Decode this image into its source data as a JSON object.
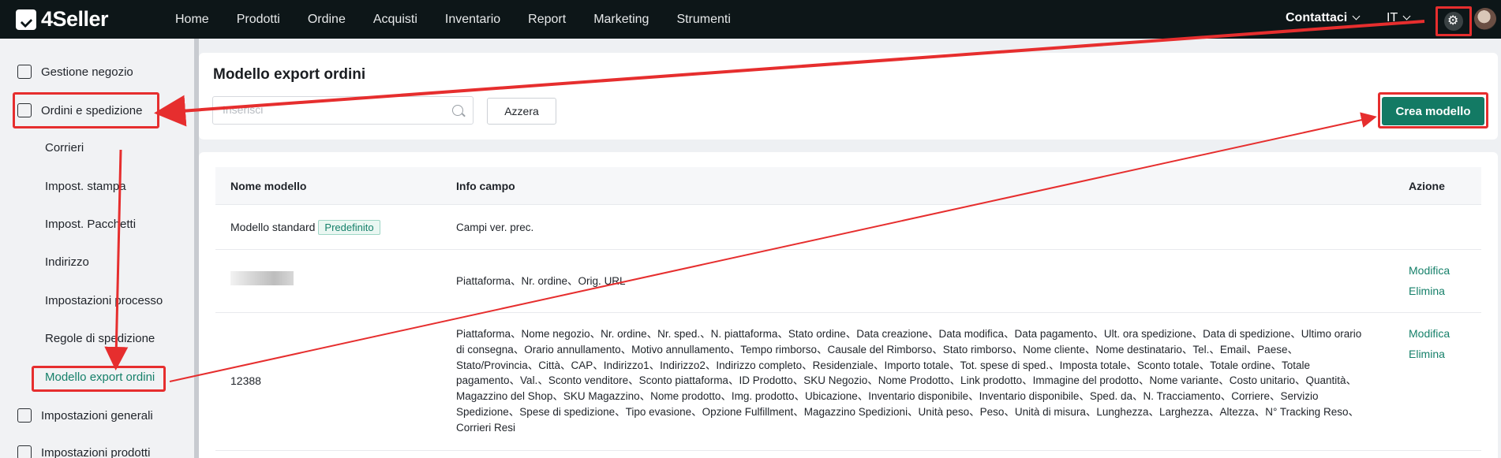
{
  "app": {
    "logo": "4Seller"
  },
  "nav": [
    "Home",
    "Prodotti",
    "Ordine",
    "Acquisti",
    "Inventario",
    "Report",
    "Marketing",
    "Strumenti"
  ],
  "topright": {
    "contact": "Contattaci",
    "lang": "IT"
  },
  "sidebar": {
    "items": [
      {
        "label": "Gestione negozio",
        "icon": "store-icon"
      },
      {
        "label": "Ordini e spedizione",
        "icon": "clipboard-icon"
      },
      {
        "label": "Impostazioni generali",
        "icon": "printer-icon"
      },
      {
        "label": "Impostazioni prodotti",
        "icon": "box-icon"
      }
    ],
    "subitems": [
      "Corrieri",
      "Impost. stampa",
      "Impost. Pacchetti",
      "Indirizzo",
      "Impostazioni processo",
      "Regole di spedizione",
      "Modello export ordini"
    ]
  },
  "page": {
    "title": "Modello export ordini",
    "search_placeholder": "Inserisci",
    "reset_label": "Azzera",
    "create_label": "Crea modello"
  },
  "table": {
    "headers": {
      "name": "Nome modello",
      "info": "Info campo",
      "action": "Azione"
    },
    "rows": [
      {
        "name": "Modello standard",
        "badge": "Predefinito",
        "info": "Campi ver. prec."
      },
      {
        "name": "",
        "info": "Piattaforma、Nr. ordine、Orig. URL",
        "edit": "Modifica",
        "delete": "Elimina"
      },
      {
        "name": "12388",
        "info": "Piattaforma、Nome negozio、Nr. ordine、Nr. sped.、N. piattaforma、Stato ordine、Data creazione、Data modifica、Data pagamento、Ult. ora spedizione、Data di spedizione、Ultimo orario di consegna、Orario annullamento、Motivo annullamento、Tempo rimborso、Causale del Rimborso、Stato rimborso、Nome cliente、Nome destinatario、Tel.、Email、Paese、Stato/Provincia、Città、CAP、Indirizzo1、Indirizzo2、Indirizzo completo、Residenziale、Importo totale、Tot. spese di sped.、Imposta totale、Sconto totale、Totale ordine、Totale pagamento、Val.、Sconto venditore、Sconto piattaforma、ID Prodotto、SKU Negozio、Nome Prodotto、Link prodotto、Immagine del prodotto、Nome variante、Costo unitario、Quantità、Magazzino del Shop、SKU Magazzino、Nome prodotto、Img. prodotto、Ubicazione、Inventario disponibile、Inventario disponibile、Sped. da、N. Tracciamento、Corriere、Servizio Spedizione、Spese di spedizione、Tipo evasione、Opzione Fulfillment、Magazzino Spedizioni、Unità peso、Peso、Unità di misura、Lunghezza、Larghezza、Altezza、N° Tracking Reso、Corrieri Resi",
        "edit": "Modifica",
        "delete": "Elimina"
      }
    ]
  },
  "colors": {
    "topbar": "#0d1618",
    "accent": "#137a64",
    "annotation": "#e62e2e"
  }
}
